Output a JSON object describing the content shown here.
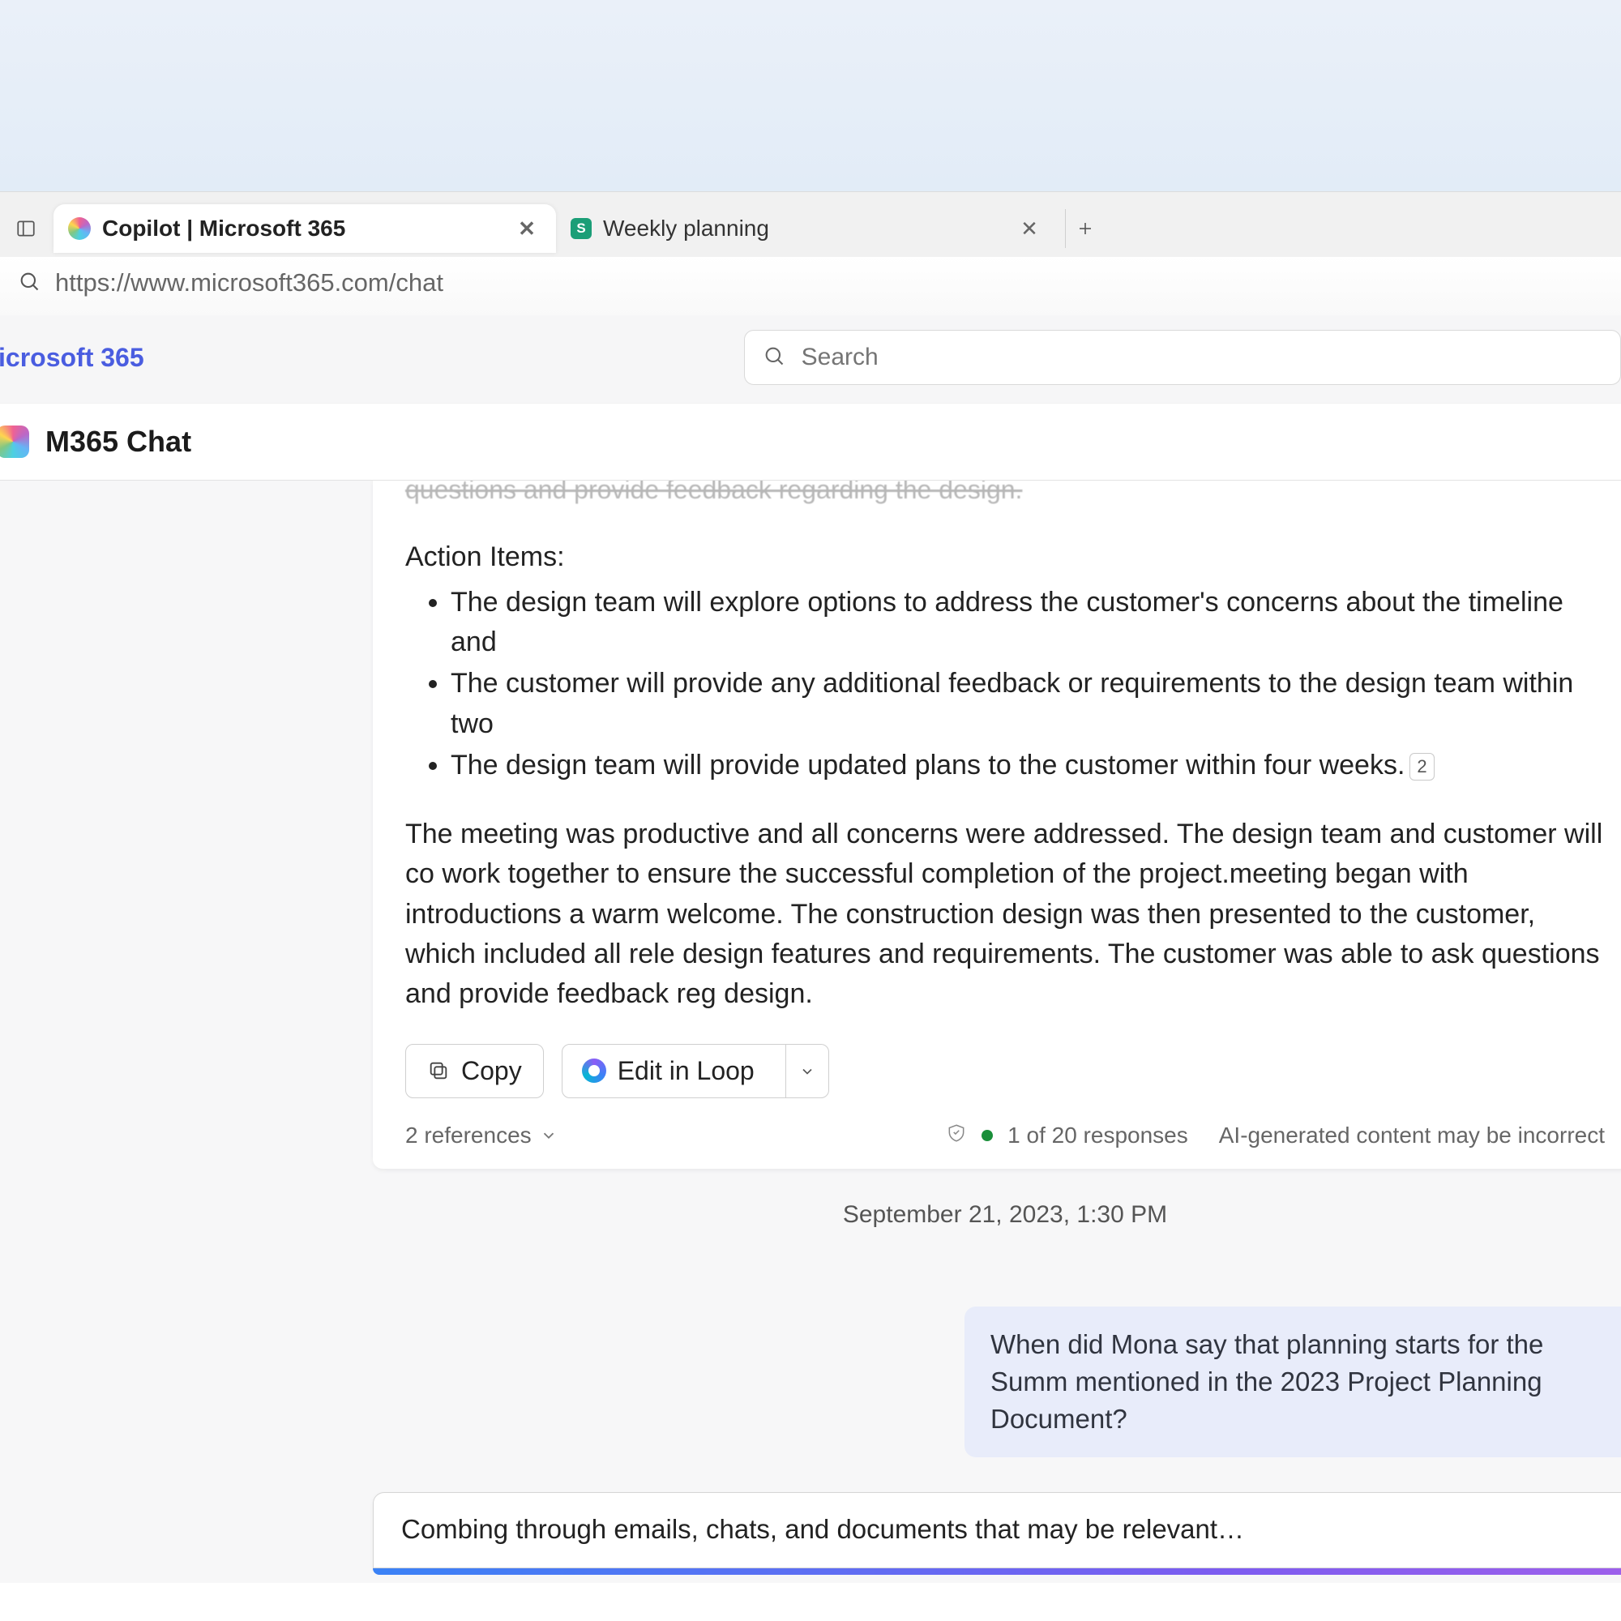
{
  "tabs": [
    {
      "title": "Copilot | Microsoft 365",
      "active": true
    },
    {
      "title": "Weekly planning",
      "active": false
    }
  ],
  "address_bar": {
    "url": "https://www.microsoft365.com/chat"
  },
  "brand_partial": "icrosoft 365",
  "search": {
    "placeholder": "Search"
  },
  "chat_header": {
    "title": "M365 Chat"
  },
  "assistant": {
    "cut_line": "questions and provide feedback regarding the design.",
    "action_items_heading": "Action Items:",
    "bullets": [
      "The design team will explore options to address the customer's concerns about the timeline and",
      "The customer will provide any additional feedback or requirements to the design team within two",
      "The design team will provide updated plans to the customer within four weeks."
    ],
    "citation": "2",
    "paragraph": "The meeting was productive and all concerns were addressed. The design team and customer will co work together to ensure the successful completion of the project.meeting began with introductions a warm welcome. The construction design was then presented to the customer, which included all rele design features and requirements. The customer was able to ask questions and provide feedback reg design.",
    "buttons": {
      "copy": "Copy",
      "loop": "Edit in Loop"
    },
    "meta": {
      "references": "2 references",
      "counter": "1 of 20 responses",
      "disclaimer": "AI-generated content may be incorrect"
    }
  },
  "timestamp": "September 21, 2023, 1:30 PM",
  "user_message": "When did Mona say that planning starts for the Summ mentioned in the 2023 Project Planning Document?",
  "composer_status": "Combing through emails, chats, and documents that may be relevant…"
}
